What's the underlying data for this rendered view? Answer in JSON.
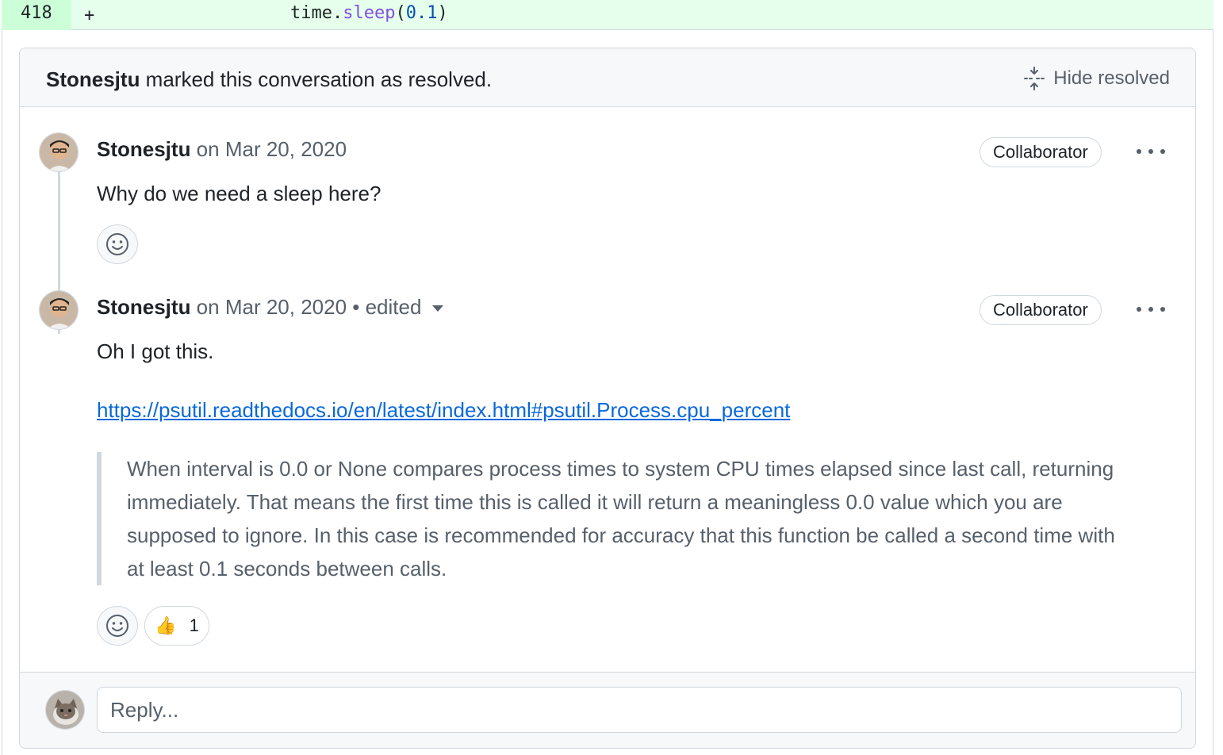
{
  "diff": {
    "line_number": "418",
    "sign": "+",
    "code_prefix": "time.",
    "code_fn": "sleep",
    "code_open": "(",
    "code_num": "0.1",
    "code_close": ")"
  },
  "resolved_bar": {
    "user": "Stonesjtu",
    "message": " marked this conversation as resolved.",
    "hide_label": "Hide resolved",
    "hide_icon": "fold-icon"
  },
  "comments": [
    {
      "author": "Stonesjtu",
      "date": " on Mar 20, 2020",
      "role": "Collaborator",
      "body": "Why do we need a sleep here?"
    },
    {
      "author": "Stonesjtu",
      "date": " on Mar 20, 2020",
      "edited": " • edited",
      "role": "Collaborator",
      "body": "Oh I got this.",
      "link": "https://psutil.readthedocs.io/en/latest/index.html#psutil.Process.cpu_percent",
      "quote": "When interval is 0.0 or None compares process times to system CPU times elapsed since last call, returning immediately. That means the first time this is called it will return a meaningless 0.0 value which you are supposed to ignore. In this case is recommended for accuracy that this function be called a second time with at least 0.1 seconds between calls.",
      "reaction": {
        "emoji": "👍",
        "count": "1"
      }
    }
  ],
  "reply": {
    "placeholder": "Reply..."
  },
  "colors": {
    "accent": "#0969da",
    "diff_added_bg": "#e6ffec",
    "diff_added_num_bg": "#ccffd8",
    "muted_text": "#57606a",
    "border": "#d0d7de"
  }
}
